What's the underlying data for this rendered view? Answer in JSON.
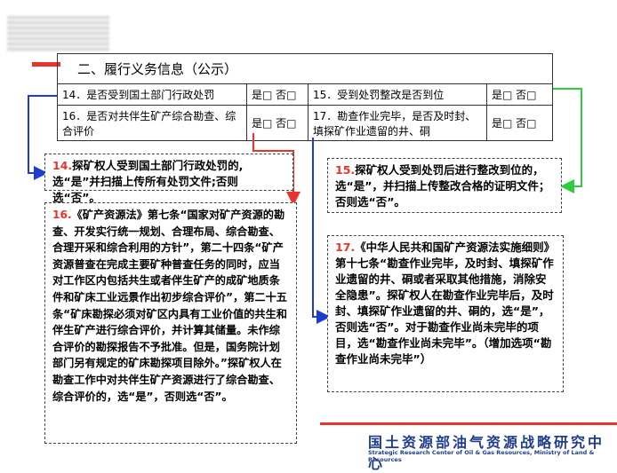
{
  "section_title": "二、履行义务信息（公示）",
  "rows": [
    {
      "q1": "14．是否受到国土部门行政处罚",
      "a1": "是□ 否□",
      "q2": "15．受到处罚整改是否到位",
      "a2": "是□ 否□"
    },
    {
      "q1": "16．是否对共伴生矿产综合勘查、综合评价",
      "a1": "是□ 否□",
      "q2": "17．勘查作业完毕，是否及时封、填探矿作业遗留的井、硐",
      "a2": "是□ 否□"
    }
  ],
  "notes": {
    "n14": {
      "num": "14.",
      "text": "探矿权人受到国土部门行政处罚的,选“是”并扫描上传所有处罚文件;否则选“否”。"
    },
    "n15": {
      "num": "15.",
      "text": "探矿权人受到处罚后进行整改到位的，选“是”，并扫描上传整改合格的证明文件；否则选“否”。"
    },
    "n16": {
      "num": "16.",
      "text": "《矿产资源法》第七条“国家对矿产资源的勘查、开发实行统一规划、合理布局、综合勘查、合理开采和综合利用的方针”，第二十四条“矿产资源普查在完成主要矿种普查任务的同时，应当对工作区内包括共生或者伴生矿产的成矿地质条件和矿床工业远景作出初步综合评价”，第二十五条“矿床勘探必须对矿区内具有工业价值的共生和伴生矿产进行综合评价，并计算其储量。未作综合评价的勘探报告不予批准。但是，国务院计划部门另有规定的矿床勘探项目除外。”探矿权人在勘查工作中对共伴生矿产资源进行了综合勘查、综合评价的，选“是”，否则选“否”。"
    },
    "n17": {
      "num": "17.",
      "text": "《中华人民共和国矿产资源法实施细则》第十七条“勘查作业完毕，及时封、填探矿作业遗留的井、硐或者采取其他措施，消除安全隐患”。探矿权人在勘查作业完毕后，及时封、填探矿作业遗留的井、硐的，选“是”，否则选“否”。对于勘查作业尚未完毕的项目，选“勘查作业尚未完毕”。（增加选项“勘查作业尚未完毕”）"
    }
  },
  "footer": {
    "cn": "国土资源部油气资源战略研究中心",
    "en": "Strategic Research Center of Oil & Gas Resources, Ministry of Land & Resources"
  },
  "colors": {
    "red": "#e8342c",
    "blue": "#1f3dcc",
    "green": "#2ecc40",
    "footer_blue": "#1f3d8a"
  }
}
